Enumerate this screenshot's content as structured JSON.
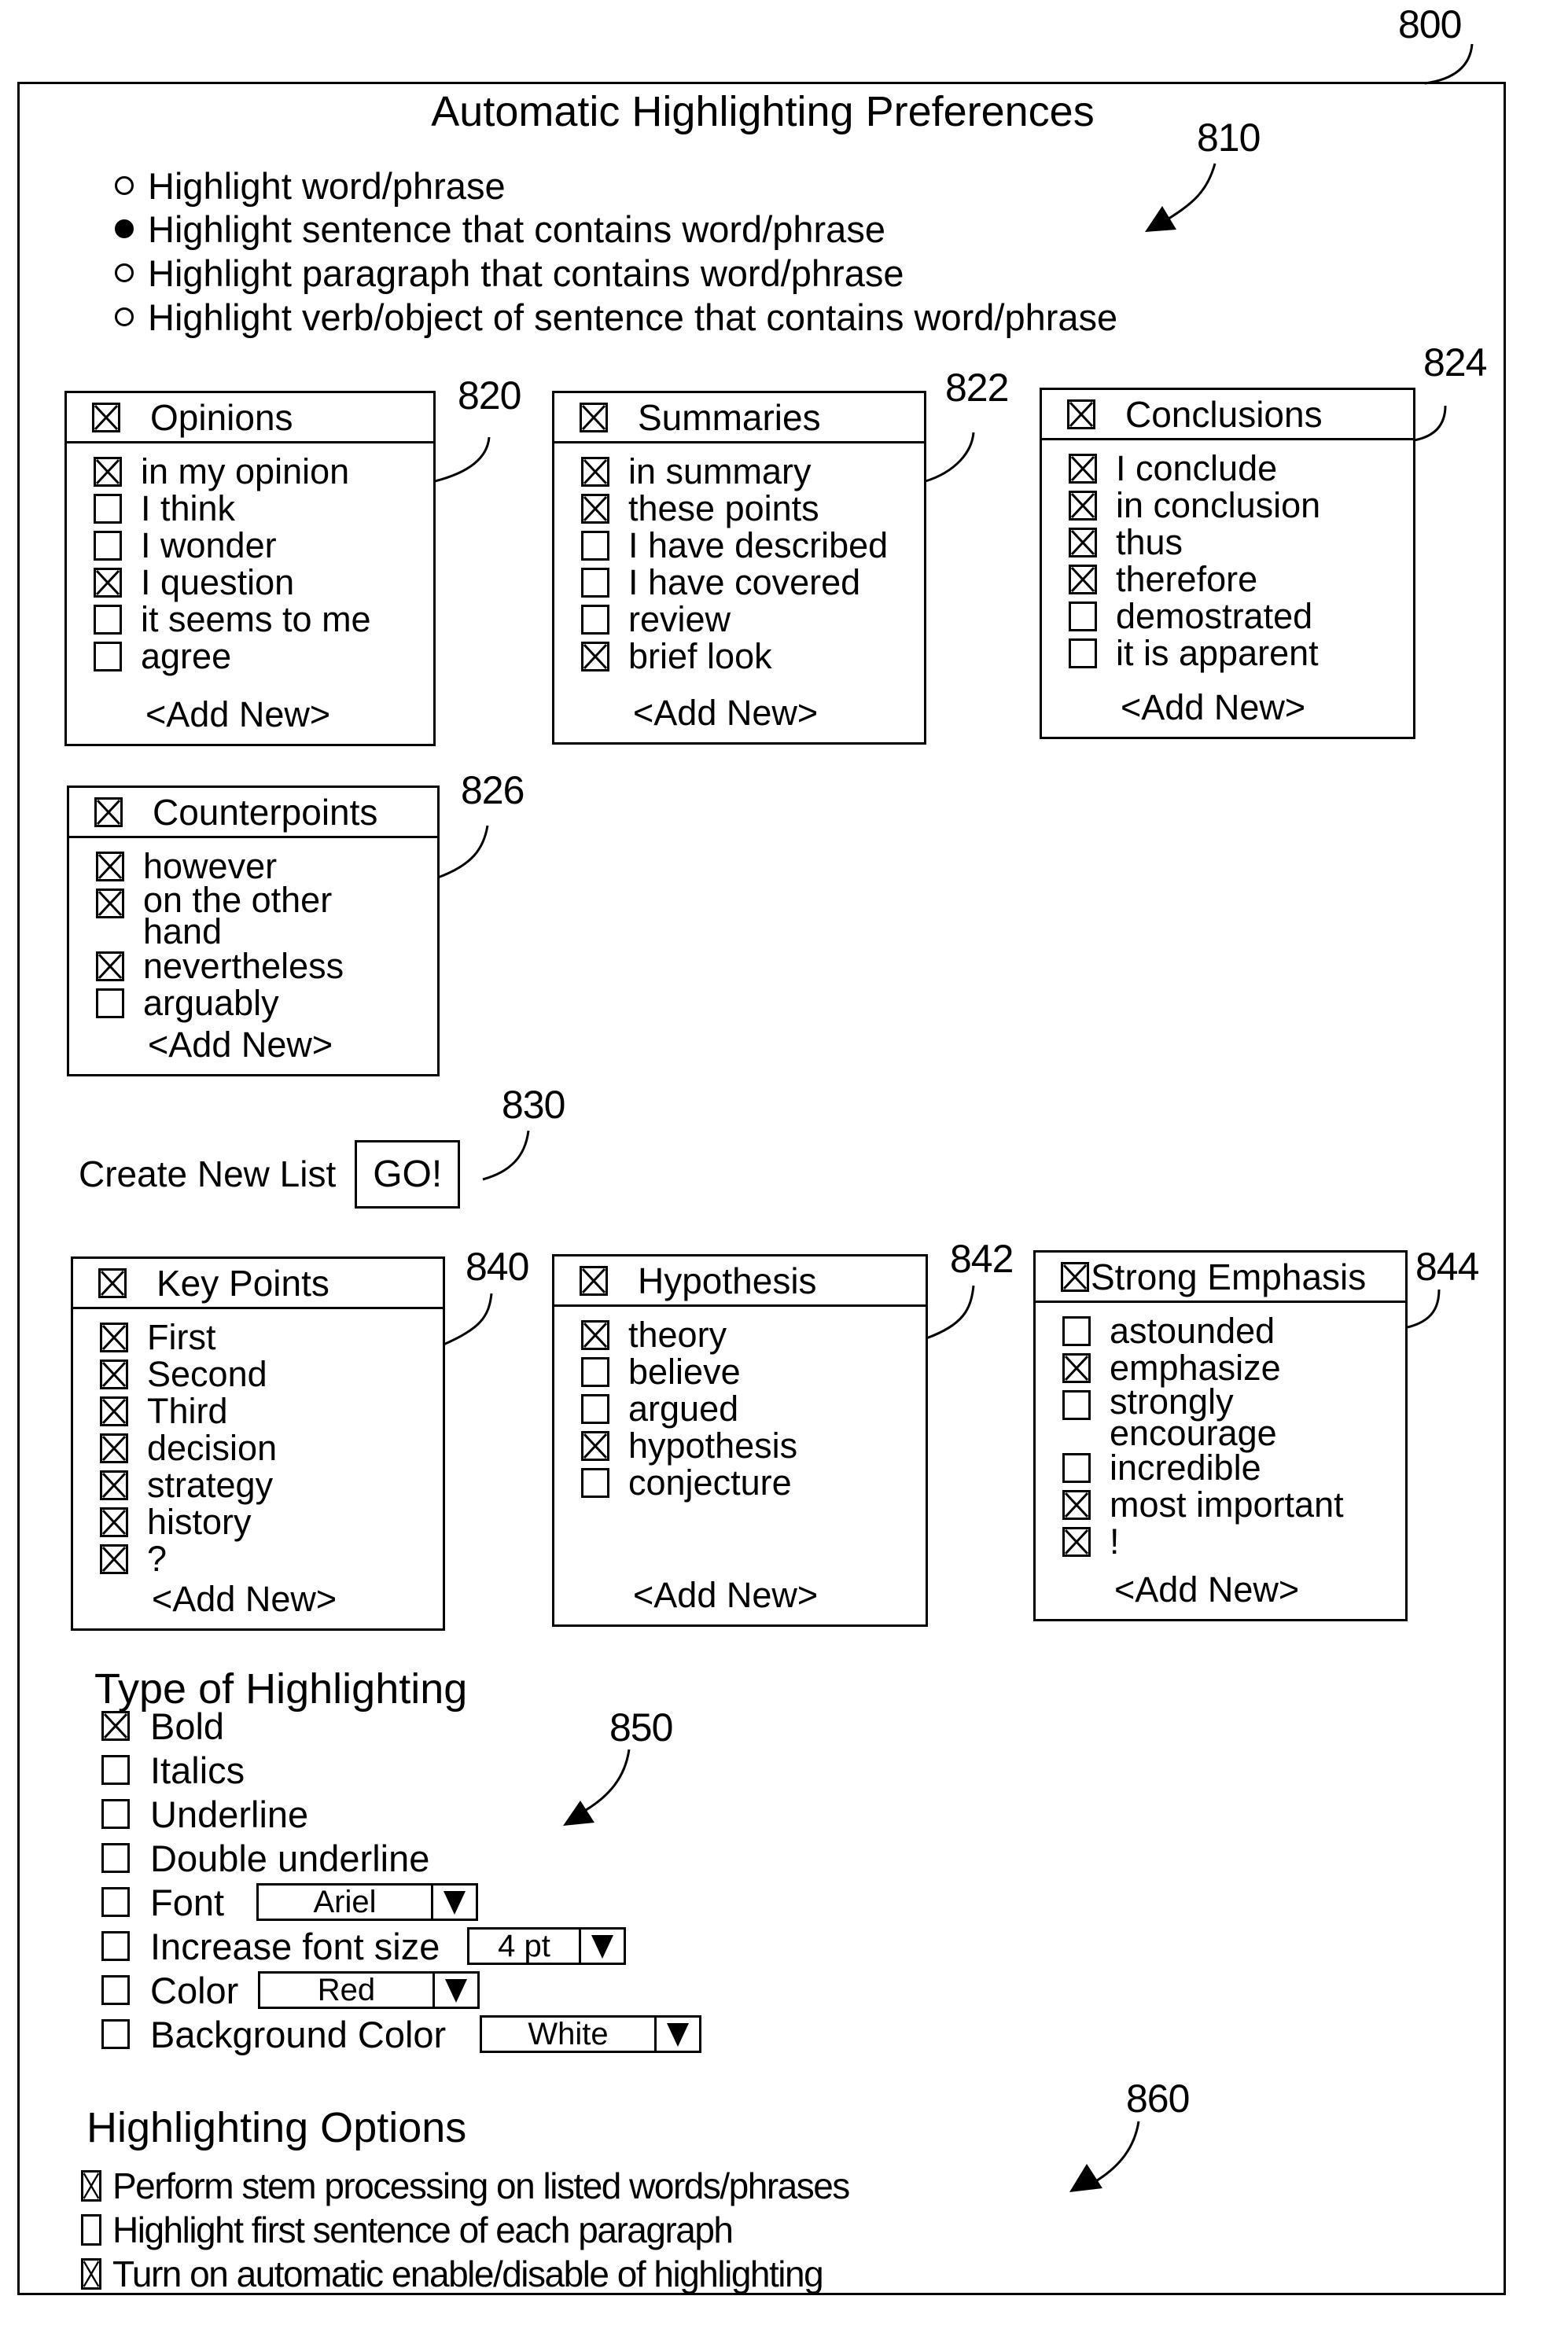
{
  "figure": {
    "ref": "800",
    "title": "Automatic Highlighting Preferences"
  },
  "highlight_scope": {
    "ref": "810",
    "options": [
      {
        "label": "Highlight word/phrase",
        "selected": false
      },
      {
        "label": "Highlight sentence that contains word/phrase",
        "selected": true
      },
      {
        "label": "Highlight paragraph that contains word/phrase",
        "selected": false
      },
      {
        "label": "Highlight verb/object of sentence that contains word/phrase",
        "selected": false
      }
    ]
  },
  "add_new_label": "<Add New>",
  "lists": [
    {
      "ref": "820",
      "title": "Opinions",
      "checked": true,
      "items": [
        {
          "label": "in my opinion",
          "checked": true
        },
        {
          "label": "I think",
          "checked": false
        },
        {
          "label": "I wonder",
          "checked": false
        },
        {
          "label": "I question",
          "checked": true
        },
        {
          "label": "it seems to me",
          "checked": false
        },
        {
          "label": "agree",
          "checked": false
        }
      ]
    },
    {
      "ref": "822",
      "title": "Summaries",
      "checked": true,
      "items": [
        {
          "label": "in summary",
          "checked": true
        },
        {
          "label": "these points",
          "checked": true
        },
        {
          "label": "I have described",
          "checked": false
        },
        {
          "label": "I have covered",
          "checked": false
        },
        {
          "label": "review",
          "checked": false
        },
        {
          "label": "brief look",
          "checked": true
        }
      ]
    },
    {
      "ref": "824",
      "title": "Conclusions",
      "checked": true,
      "items": [
        {
          "label": "I conclude",
          "checked": true
        },
        {
          "label": "in conclusion",
          "checked": true
        },
        {
          "label": "thus",
          "checked": true
        },
        {
          "label": "therefore",
          "checked": true
        },
        {
          "label": "demostrated",
          "checked": false
        },
        {
          "label": "it is apparent",
          "checked": false
        }
      ]
    },
    {
      "ref": "826",
      "title": "Counterpoints",
      "checked": true,
      "items": [
        {
          "label": "however",
          "checked": true
        },
        {
          "label": "on the other hand",
          "checked": true
        },
        {
          "label": "nevertheless",
          "checked": true
        },
        {
          "label": "arguably",
          "checked": false
        }
      ]
    },
    {
      "ref": "840",
      "title": "Key Points",
      "checked": true,
      "items": [
        {
          "label": "First",
          "checked": true
        },
        {
          "label": "Second",
          "checked": true
        },
        {
          "label": "Third",
          "checked": true
        },
        {
          "label": "decision",
          "checked": true
        },
        {
          "label": "strategy",
          "checked": true
        },
        {
          "label": "history",
          "checked": true
        },
        {
          "label": "?",
          "checked": true
        }
      ]
    },
    {
      "ref": "842",
      "title": "Hypothesis",
      "checked": true,
      "items": [
        {
          "label": "theory",
          "checked": true
        },
        {
          "label": "believe",
          "checked": false
        },
        {
          "label": "argued",
          "checked": false
        },
        {
          "label": "hypothesis",
          "checked": true
        },
        {
          "label": "conjecture",
          "checked": false
        }
      ]
    },
    {
      "ref": "844",
      "title": "Strong Emphasis",
      "checked": true,
      "items": [
        {
          "label": "astounded",
          "checked": false
        },
        {
          "label": "emphasize",
          "checked": true
        },
        {
          "label": "strongly encourage",
          "checked": false
        },
        {
          "label": "incredible",
          "checked": false
        },
        {
          "label": "most important",
          "checked": true
        },
        {
          "label": "!",
          "checked": true
        }
      ]
    }
  ],
  "create_list": {
    "ref": "830",
    "label": "Create New List",
    "button_label": "GO!"
  },
  "highlight_type": {
    "ref": "850",
    "heading": "Type of Highlighting",
    "options": [
      {
        "label": "Bold",
        "checked": true
      },
      {
        "label": "Italics",
        "checked": false
      },
      {
        "label": "Underline",
        "checked": false
      },
      {
        "label": "Double underline",
        "checked": false
      },
      {
        "label": "Font",
        "checked": false,
        "select_value": "Ariel"
      },
      {
        "label": "Increase font size",
        "checked": false,
        "select_value": "4 pt"
      },
      {
        "label": "Color",
        "checked": false,
        "select_value": "Red"
      },
      {
        "label": "Background Color",
        "checked": false,
        "select_value": "White"
      }
    ]
  },
  "highlight_options": {
    "ref": "860",
    "heading": "Highlighting Options",
    "options": [
      {
        "label": "Perform stem processing on listed words/phrases",
        "checked": true
      },
      {
        "label": "Highlight first sentence of each paragraph",
        "checked": false
      },
      {
        "label": "Turn on automatic enable/disable of highlighting",
        "checked": true
      }
    ]
  }
}
